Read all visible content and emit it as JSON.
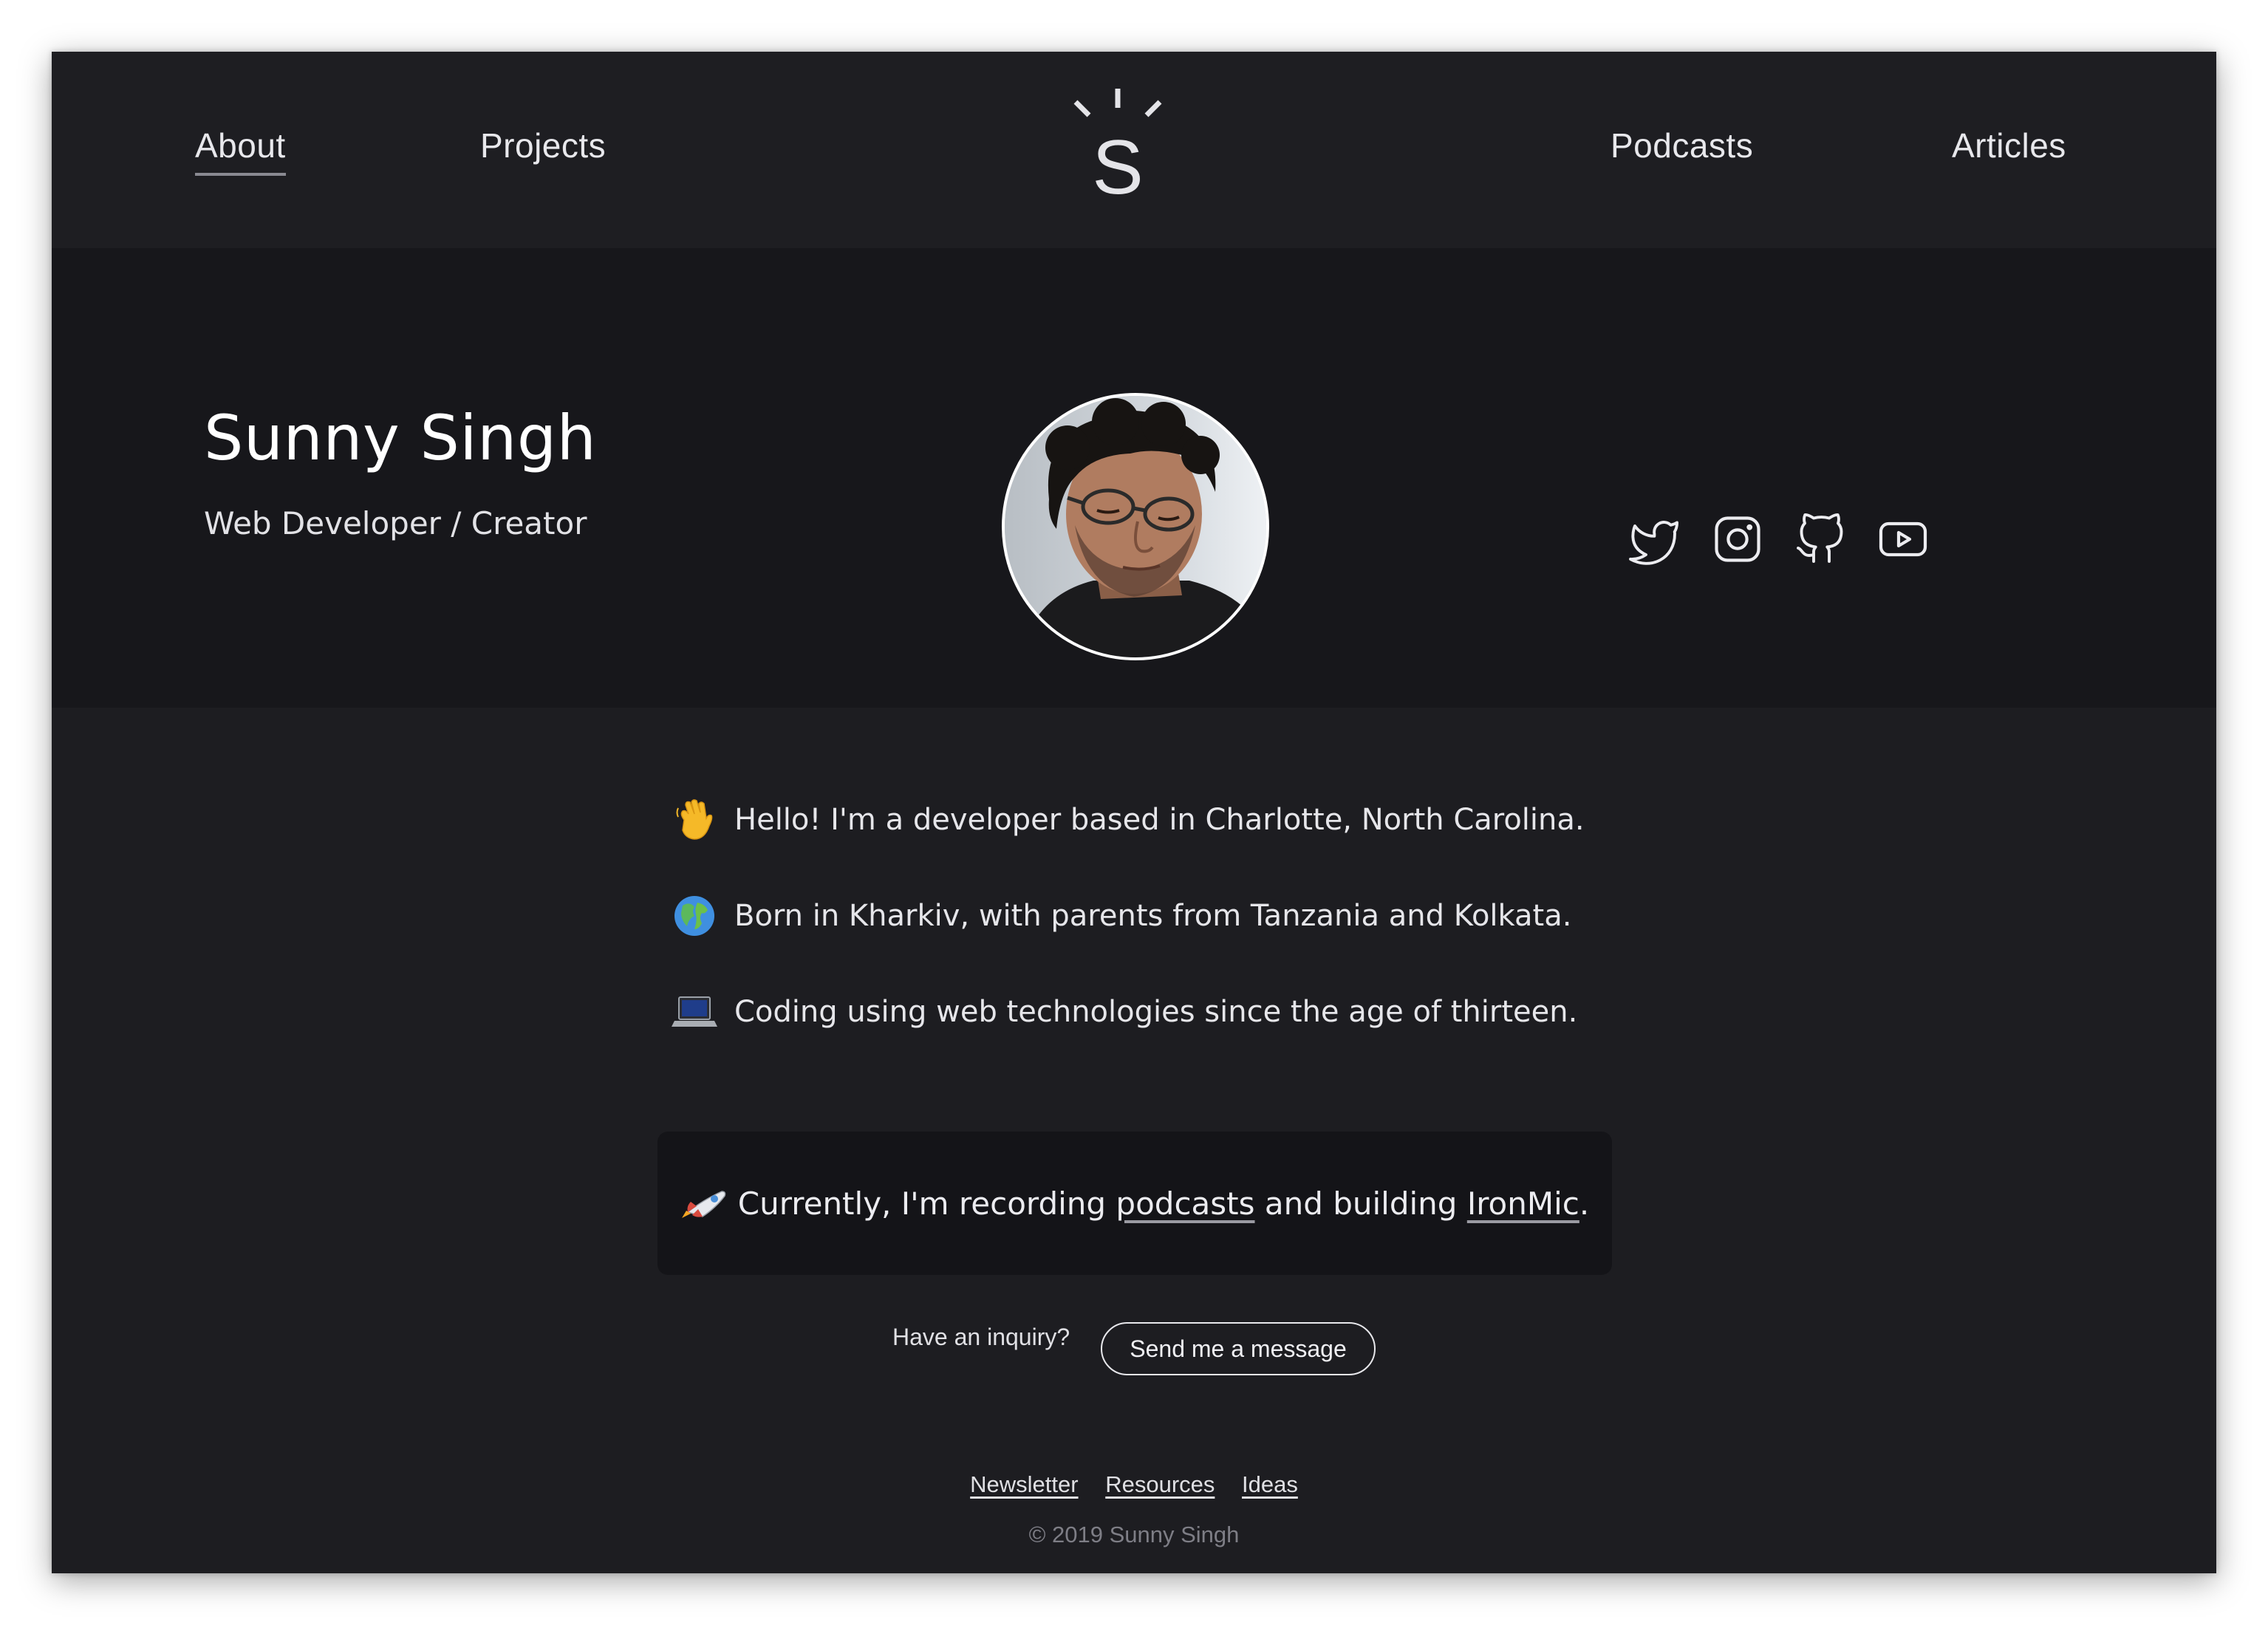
{
  "nav": {
    "about": "About",
    "projects": "Projects",
    "podcasts": "Podcasts",
    "articles": "Articles",
    "logo_letter": "S",
    "active": "About"
  },
  "hero": {
    "name": "Sunny Singh",
    "tagline": "Web Developer / Creator",
    "social_icons": [
      "twitter-icon",
      "instagram-icon",
      "github-icon",
      "youtube-icon"
    ]
  },
  "facts": [
    {
      "icon": "waving-hand-icon",
      "text": "Hello! I'm a developer based in Charlotte, North Carolina."
    },
    {
      "icon": "globe-icon",
      "text": "Born in Kharkiv, with parents from Tanzania and Kolkata."
    },
    {
      "icon": "laptop-icon",
      "text": "Coding using web technologies since the age of thirteen."
    }
  ],
  "callout": {
    "icon": "rocket-icon",
    "prefix": "Currently, I'm recording",
    "link1": "podcasts",
    "middle": "and building",
    "link2": "IronMic",
    "suffix": "."
  },
  "contact": {
    "prompt": "Have an inquiry?",
    "button": "Send me a message"
  },
  "footer": {
    "links": [
      "Newsletter",
      "Resources",
      "Ideas"
    ],
    "copyright": "© 2019 Sunny Singh"
  },
  "colors": {
    "nav_bg": "#1e1e22",
    "hero_bg": "#17171b",
    "body_bg": "#1d1d21",
    "callout_bg": "#141418",
    "text": "#e6e6ea",
    "muted": "#7e7e86"
  }
}
